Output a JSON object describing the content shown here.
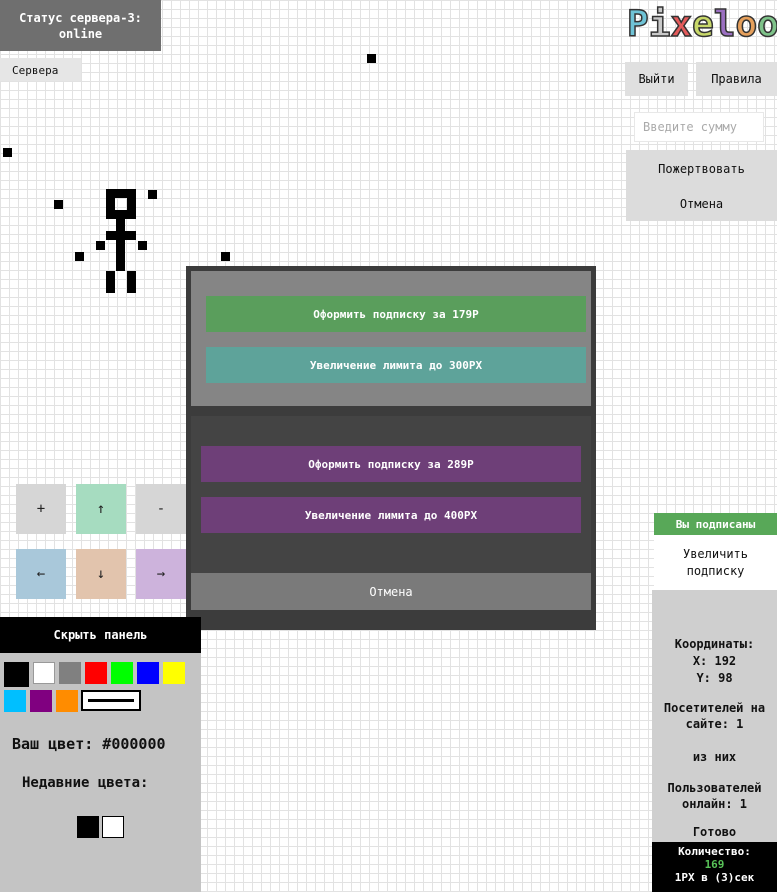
{
  "status": {
    "line1": "Статус сервера-3:",
    "line2": "online"
  },
  "servers_button": "Сервера",
  "logo": {
    "letters": [
      "P",
      "i",
      "x",
      "e",
      "l",
      "o",
      "o"
    ],
    "colors": [
      "#6fc3d6",
      "#c9c9c9",
      "#e45b5b",
      "#c8d86a",
      "#9b6fc1",
      "#e6a05c",
      "#7fc38a"
    ]
  },
  "nav": {
    "logout": "Выйти",
    "rules": "Правила"
  },
  "donate": {
    "placeholder": "Введите сумму",
    "donate_label": "Пожертвовать",
    "cancel_label": "Отмена"
  },
  "modal": {
    "buttons_top": [
      {
        "label": "Оформить подписку за 179Р",
        "color": "#5a9e5c"
      },
      {
        "label": "Увеличение лимита до 300PX",
        "color": "#5ea39a"
      }
    ],
    "buttons_bottom": [
      {
        "label": "Оформить подписку за 289Р",
        "color": "#6e3f78"
      },
      {
        "label": "Увеличение лимита до 400PX",
        "color": "#6e3f78"
      }
    ],
    "cancel": "Отмена"
  },
  "controls": {
    "zoom_in": "+",
    "up": "↑",
    "zoom_out": "-",
    "left": "←",
    "down": "↓",
    "right": "→"
  },
  "panel": {
    "hide_label": "Скрыть панель",
    "palette": [
      "#000000",
      "#ffffff",
      "#808080",
      "#ff0000",
      "#00ff00",
      "#0000ff",
      "#ffff00",
      "#00bfff",
      "#800080",
      "#ff8c00"
    ],
    "your_color": "Ваш цвет: #000000",
    "recent_label": "Недавние цвета:",
    "recent_colors": [
      "#000000",
      "#ffffff"
    ]
  },
  "subscription": {
    "badge": "Вы подписаны",
    "upgrade": "Увеличить подписку"
  },
  "info": {
    "coords_label": "Координаты:",
    "x": "X: 192",
    "y": "Y: 98",
    "visitors": "Посетителей на сайте: 1",
    "of_them": "из них",
    "users_online": "Пользователей онлайн: 1",
    "ready": "Готово"
  },
  "count": {
    "label": "Количество:",
    "value": "169",
    "rate": "1PX в (3)сек",
    "value_color": "#58c258"
  }
}
